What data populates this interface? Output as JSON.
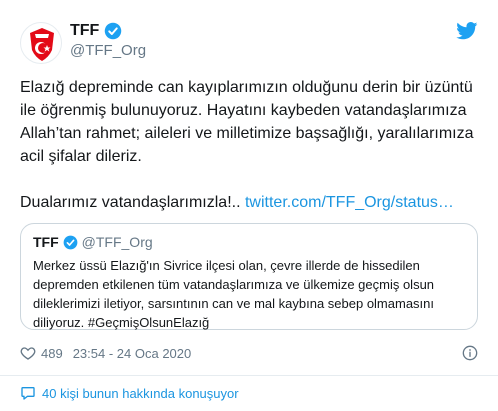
{
  "account": {
    "display_name": "TFF",
    "handle": "@TFF_Org",
    "verified": true
  },
  "tweet": {
    "lines": [
      "Elazığ depreminde can kayıplarımızın olduğunu derin bir üzüntü",
      "ile öğrenmiş bulunuyoruz. Hayatını kaybeden vatandaşlarımıza",
      "Allah’tan rahmet; aileleri ve milletimize başsağlığı, yaralılarımıza",
      "acil şifalar dileriz."
    ],
    "second_line_text": "Dualarımız vatandaşlarımızla!..",
    "link_text": "twitter.com/TFF_Org/status…"
  },
  "quoted": {
    "display_name": "TFF",
    "handle": "@TFF_Org",
    "lines": [
      "Merkez üssü Elazığ'ın Sivrice ilçesi olan, çevre illerde de hissedilen",
      "depremden etkilenen tüm vatandaşlarımıza ve ülkemize geçmiş olsun",
      "dileklerimizi iletiyor, sarsıntının can ve mal kaybına sebep olmamasını",
      "diliyoruz. #GeçmişOlsunElazığ"
    ]
  },
  "meta": {
    "likes": "489",
    "timestamp": "23:54 - 24 Oca 2020"
  },
  "footer": {
    "conversation_text": "40 kişi bunun hakkında konuşuyor"
  },
  "colors": {
    "accent": "#1b95e0",
    "muted": "#657786",
    "text": "#14171a",
    "border": "#ccd6dd",
    "brand_red": "#e30a17"
  },
  "icons": {
    "avatar": "tff-logo",
    "verified": "verified-badge-icon",
    "brand": "twitter-bird-icon",
    "like": "heart-icon",
    "info": "info-icon",
    "reply": "speech-bubble-icon"
  }
}
